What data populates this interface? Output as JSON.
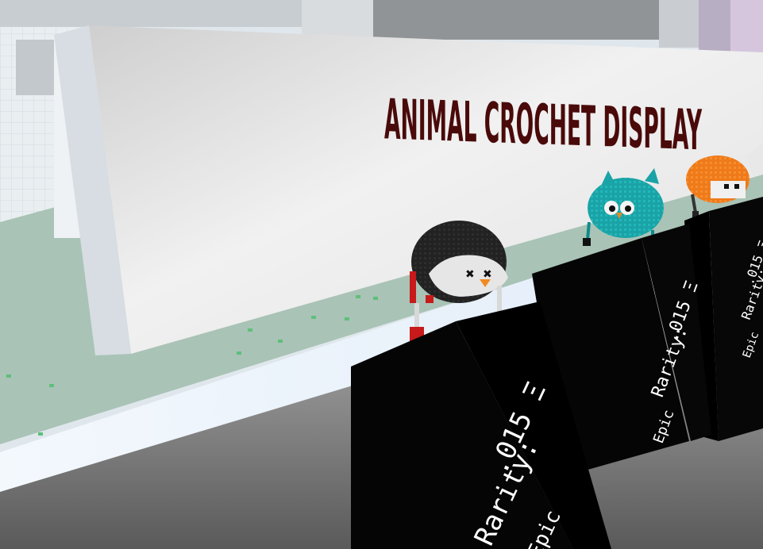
{
  "sign": {
    "title": "ANIMAL CROCHET DISPLAY"
  },
  "pedestals": [
    {
      "price": ".015 Ξ",
      "rarity_label": "Rarity:",
      "rarity": "Epic",
      "hat": "penguin-hat"
    },
    {
      "price": ".015 Ξ",
      "rarity_label": "Rarity:",
      "rarity": "Epic",
      "hat": "owl-hat"
    },
    {
      "price": ".015 Ξ",
      "rarity_label": "Rarity:",
      "rarity": "Epic",
      "hat": "fox-hat"
    }
  ],
  "colors": {
    "sky": "#dfe7ec",
    "wall": "#e8e8e8",
    "floor_path": "#e6f0fa",
    "grass": "#a9c3b6",
    "pedestal": "#050505",
    "sign_text": "#4a0a0a",
    "penguin": "#1f1f1f",
    "owl": "#1aa3a6",
    "fox": "#ef7a1a",
    "pompom_red": "#c81a1a"
  }
}
